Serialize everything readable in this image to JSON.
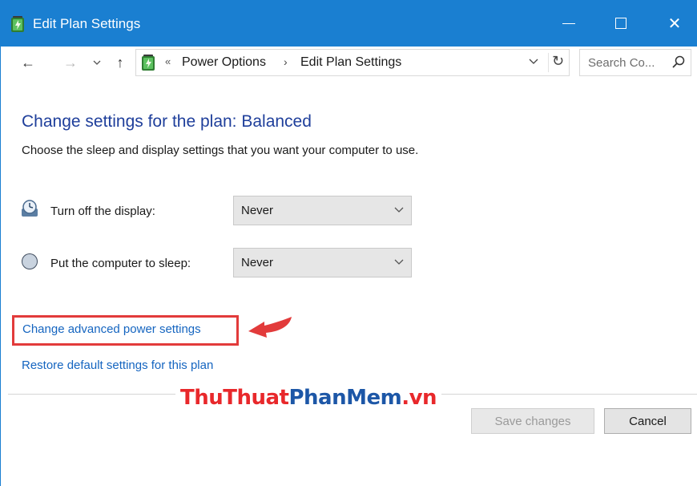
{
  "window": {
    "title": "Edit Plan Settings",
    "accent_color": "#1a7fd1"
  },
  "titlebar": {
    "icon": "power-options-icon",
    "minimize_icon": "minimize-icon",
    "maximize_icon": "maximize-icon",
    "close_icon": "close-icon",
    "close_glyph": "✕"
  },
  "navigation": {
    "back_glyph": "←",
    "forward_glyph": "→",
    "recent_glyph": "⌄",
    "up_glyph": "↑",
    "breadcrumb_overflow": "«",
    "breadcrumb": [
      "Power Options",
      "Edit Plan Settings"
    ],
    "breadcrumb_separator": "›",
    "dropdown_glyph": "⌄",
    "refresh_glyph": "↻",
    "search_placeholder": "Search Co..."
  },
  "main": {
    "heading": "Change settings for the plan: Balanced",
    "subtitle": "Choose the sleep and display settings that you want your computer to use.",
    "settings": [
      {
        "label": "Turn off the display:",
        "value": "Never",
        "icon": "display-timer-icon"
      },
      {
        "label": "Put the computer to sleep:",
        "value": "Never",
        "icon": "sleep-moon-icon"
      }
    ],
    "advanced_link": "Change advanced power settings",
    "restore_link": "Restore default settings for this plan",
    "highlight_color": "#e23b3b"
  },
  "watermark": {
    "part1": "ThuThuat",
    "part2": "PhanMem",
    "part3": ".vn"
  },
  "footer": {
    "save_label": "Save changes",
    "save_enabled": false,
    "cancel_label": "Cancel"
  }
}
